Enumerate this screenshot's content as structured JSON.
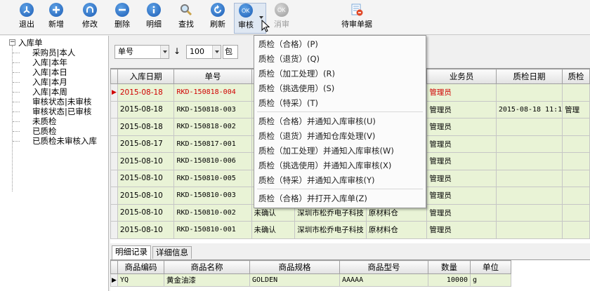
{
  "toolbar": {
    "buttons": [
      {
        "label": "退出",
        "icon": "exit-icon"
      },
      {
        "label": "新增",
        "icon": "plus-icon"
      },
      {
        "label": "修改",
        "icon": "edit-icon"
      },
      {
        "label": "删除",
        "icon": "minus-icon"
      },
      {
        "label": "明细",
        "icon": "info-icon"
      },
      {
        "label": "查找",
        "icon": "search-icon"
      },
      {
        "label": "刷新",
        "icon": "refresh-icon"
      },
      {
        "label": "审核",
        "icon": "approve-icon"
      },
      {
        "label": "消审",
        "icon": "unapprove-icon"
      },
      {
        "label": "待审单据",
        "icon": "pending-document-icon"
      }
    ]
  },
  "tree": {
    "root": "入库单",
    "items": [
      "采购员|本人",
      "入库|本年",
      "入库|本日",
      "入库|本月",
      "入库|本周",
      "审核状态|未审核",
      "审核状态|已审核",
      "未质检",
      "已质检",
      "已质检未审核入库"
    ]
  },
  "filter": {
    "field": "单号",
    "sort_icon": "↓",
    "count": "100",
    "mode": "包"
  },
  "grid": {
    "columns": [
      "入库日期",
      "单号",
      "",
      "",
      "",
      "业务员",
      "质检日期",
      "质检"
    ],
    "rows": [
      {
        "date": "2015-08-18",
        "no": "RKD-150818-004",
        "status": "",
        "supplier": "",
        "warehouse": "",
        "clerk": "管理员",
        "qc_date": "",
        "qc": ""
      },
      {
        "date": "2015-08-18",
        "no": "RKD-150818-003",
        "status": "",
        "supplier": "",
        "warehouse": "",
        "clerk": "管理员",
        "qc_date": "2015-08-18 11:1",
        "qc": "管理"
      },
      {
        "date": "2015-08-18",
        "no": "RKD-150818-002",
        "status": "",
        "supplier": "",
        "warehouse": "",
        "clerk": "管理员",
        "qc_date": "",
        "qc": ""
      },
      {
        "date": "2015-08-17",
        "no": "RKD-150817-001",
        "status": "",
        "supplier": "",
        "warehouse": "",
        "clerk": "管理员",
        "qc_date": "",
        "qc": ""
      },
      {
        "date": "2015-08-10",
        "no": "RKD-150810-006",
        "status": "",
        "supplier": "",
        "warehouse": "",
        "clerk": "管理员",
        "qc_date": "",
        "qc": ""
      },
      {
        "date": "2015-08-10",
        "no": "RKD-150810-005",
        "status": "",
        "supplier": "",
        "warehouse": "",
        "clerk": "管理员",
        "qc_date": "",
        "qc": ""
      },
      {
        "date": "2015-08-10",
        "no": "RKD-150810-003",
        "status": "",
        "supplier": "",
        "warehouse": "",
        "clerk": "管理员",
        "qc_date": "",
        "qc": ""
      },
      {
        "date": "2015-08-10",
        "no": "RKD-150810-002",
        "status": "未确认",
        "supplier": "深圳市松乔电子科技",
        "warehouse": "原材料仓",
        "clerk": "管理员",
        "qc_date": "",
        "qc": ""
      },
      {
        "date": "2015-08-10",
        "no": "RKD-150810-001",
        "status": "未确认",
        "supplier": "深圳市松乔电子科技",
        "warehouse": "原材料仓",
        "clerk": "管理员",
        "qc_date": "",
        "qc": ""
      }
    ]
  },
  "menu": {
    "group1": [
      "质检（合格）(P)",
      "质检（退货）(Q)",
      "质检（加工处理）(R)",
      "质检（挑选使用）(S)",
      "质检（特采）(T)"
    ],
    "group2": [
      "质检（合格）并通知入库审核(U)",
      "质检（退货）并通知仓库处理(V)",
      "质检（加工处理）并通知入库审核(W)",
      "质检（挑选使用）并通知入库审核(X)",
      "质检（特采）并通知入库审核(Y)"
    ],
    "group3": [
      "质检（合格）并打开入库单(Z)"
    ]
  },
  "bottom_tabs": [
    "明细记录",
    "详细信息"
  ],
  "detail": {
    "columns": [
      "商品编码",
      "商品名称",
      "商品规格",
      "商品型号",
      "数量",
      "单位"
    ],
    "rows": [
      {
        "code": "YQ",
        "name": "黄金油漆",
        "spec": "GOLDEN",
        "model": "AAAAA",
        "qty": "10000",
        "unit": "g"
      }
    ]
  },
  "colors": {
    "accent": "#1d5db5",
    "row_bg": "#e9f3d6",
    "selected_text": "#d00000"
  }
}
